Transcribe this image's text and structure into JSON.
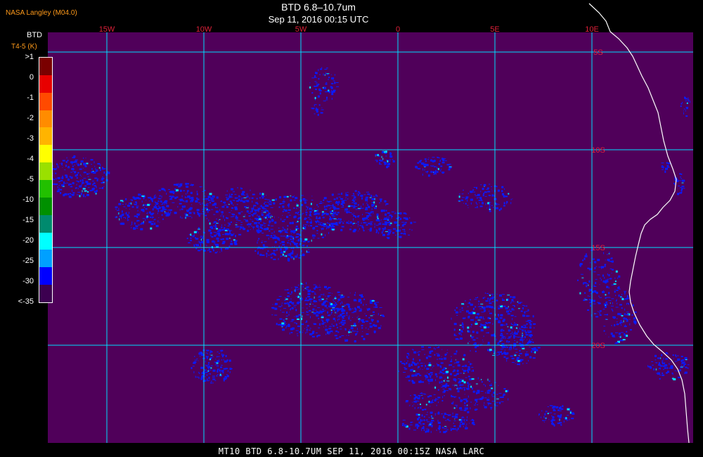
{
  "header": {
    "org": "NASA Langley (M04.0)",
    "title": "BTD 6.8–10.7um",
    "subtitle": "Sep 11, 2016 00:15 UTC"
  },
  "legend": {
    "title": "BTD",
    "subtitle": "T4-5 (K)",
    "labels": [
      ">1",
      "0",
      "-1",
      "-2",
      "-3",
      "-4",
      "-5",
      "-10",
      "-15",
      "-20",
      "-25",
      "-30",
      "<-35"
    ],
    "colors": [
      "#7a0000",
      "#e80000",
      "#ff4a00",
      "#ff8c00",
      "#ffb400",
      "#ffff00",
      "#9ae000",
      "#22c000",
      "#009000",
      "#008a6e",
      "#00ffff",
      "#00a0ff",
      "#0000ff",
      "#3c0050"
    ]
  },
  "map": {
    "background_color": "#50005a",
    "grid_color": "#00e0ff",
    "tick_color": "#e0203a",
    "coast_color": "#ffffff",
    "cloud_color": "#0a1aff",
    "cloud_highlight_color": "#00e0ff",
    "lon_ticks": [
      {
        "label": "15W",
        "value": -15
      },
      {
        "label": "10W",
        "value": -10
      },
      {
        "label": "5W",
        "value": -5
      },
      {
        "label": "0",
        "value": 0
      },
      {
        "label": "5E",
        "value": 5
      },
      {
        "label": "10E",
        "value": 10
      }
    ],
    "lat_ticks": [
      {
        "label": "5S",
        "value": -5
      },
      {
        "label": "10S",
        "value": -10
      },
      {
        "label": "15S",
        "value": -15
      },
      {
        "label": "20S",
        "value": -20
      }
    ]
  },
  "footer": {
    "text": "MT10  BTD 6.8-10.7UM  SEP 11, 2016 00:15Z  NASA LARC"
  }
}
